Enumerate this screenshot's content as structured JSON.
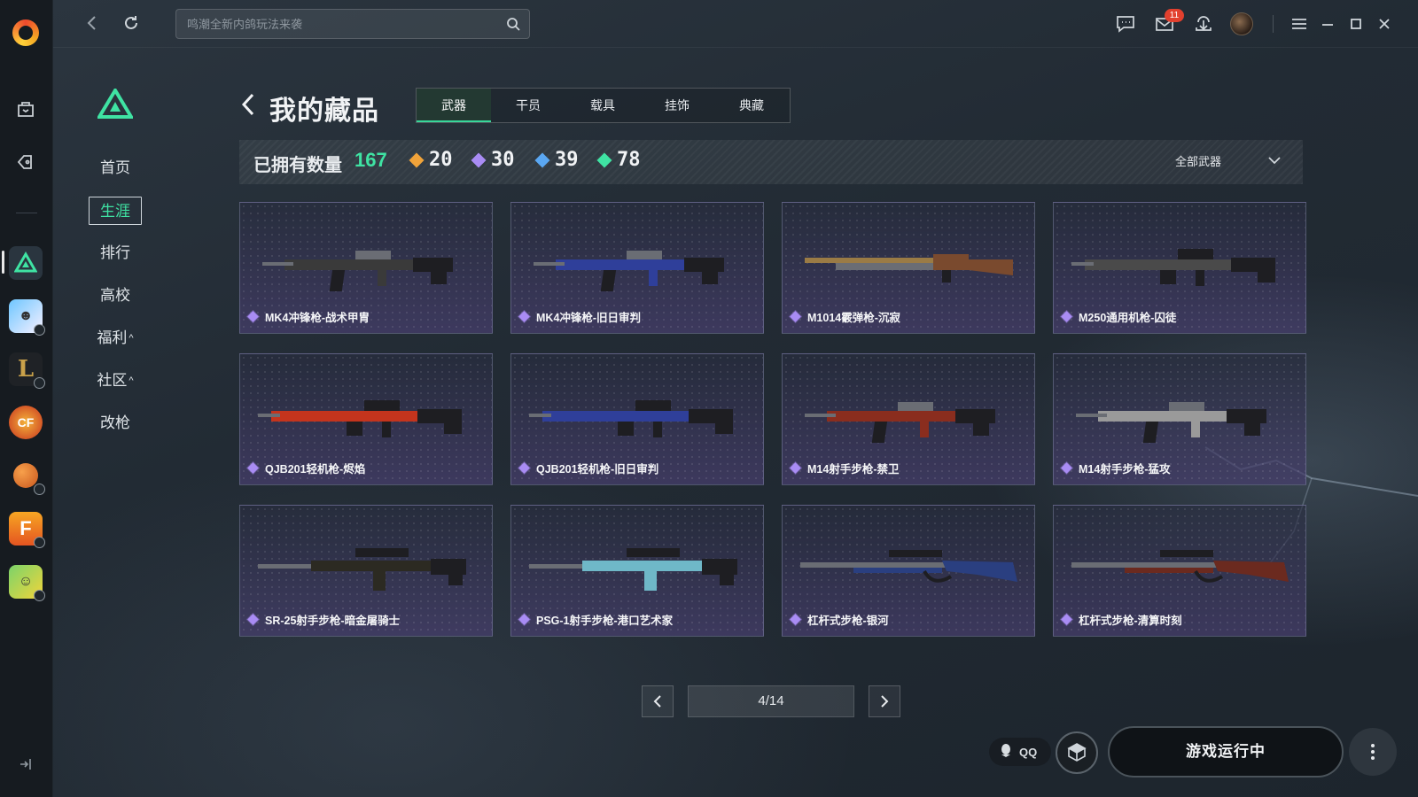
{
  "app": {
    "accent": "#3fe3a3"
  },
  "topbar": {
    "search_placeholder": "鸣潮全新内鸽玩法来袭",
    "mail_badge": "11"
  },
  "menu": {
    "items": [
      {
        "label": "首页"
      },
      {
        "label": "生涯",
        "active": true
      },
      {
        "label": "排行"
      },
      {
        "label": "高校"
      },
      {
        "label": "福利",
        "caret": "^"
      },
      {
        "label": "社区",
        "caret": "^"
      },
      {
        "label": "改枪"
      }
    ]
  },
  "header": {
    "title": "我的藏品",
    "tabs": [
      {
        "label": "武器",
        "active": true
      },
      {
        "label": "干员"
      },
      {
        "label": "载具"
      },
      {
        "label": "挂饰"
      },
      {
        "label": "典藏"
      }
    ]
  },
  "stats": {
    "owned_label": "已拥有数量",
    "owned_count": "167",
    "rarities": [
      {
        "value": "20",
        "color": "#f0a33a"
      },
      {
        "value": "30",
        "color": "#a98cf4"
      },
      {
        "value": "39",
        "color": "#5aa7f2"
      },
      {
        "value": "78",
        "color": "#3fe3a3"
      }
    ],
    "filter_label": "全部武器"
  },
  "weapons": [
    {
      "name": "MK4冲锋枪-战术甲胄",
      "icon": "rifle-icon",
      "accent": "#3a3a3a"
    },
    {
      "name": "MK4冲锋枪-旧日审判",
      "icon": "rifle-icon",
      "accent": "#2f3f9a"
    },
    {
      "name": "M1014霰弹枪-沉寂",
      "icon": "shotgun-icon",
      "accent": "#7a4a2e"
    },
    {
      "name": "M250通用机枪-囚徒",
      "icon": "machine-gun-icon",
      "accent": "#4a4a4a"
    },
    {
      "name": "QJB201轻机枪-烬焰",
      "icon": "machine-gun-icon",
      "accent": "#c4341d"
    },
    {
      "name": "QJB201轻机枪-旧日审判",
      "icon": "machine-gun-icon",
      "accent": "#2f3f9a"
    },
    {
      "name": "M14射手步枪-禁卫",
      "icon": "rifle-icon",
      "accent": "#8a2d1e"
    },
    {
      "name": "M14射手步枪-猛攻",
      "icon": "rifle-icon",
      "accent": "#9a9a9a"
    },
    {
      "name": "SR-25射手步枪-暗金屠骑士",
      "icon": "sniper-icon",
      "accent": "#2c2a22"
    },
    {
      "name": "PSG-1射手步枪-港口艺术家",
      "icon": "sniper-icon",
      "accent": "#6fb8c8"
    },
    {
      "name": "杠杆式步枪-银河",
      "icon": "lever-rifle-icon",
      "accent": "#2a3f80"
    },
    {
      "name": "杠杆式步枪-清算时刻",
      "icon": "lever-rifle-icon",
      "accent": "#6b2a1f"
    }
  ],
  "pagination": {
    "current": "4/14"
  },
  "bottom": {
    "qq_label": "QQ",
    "launch_label": "游戏运行中"
  }
}
